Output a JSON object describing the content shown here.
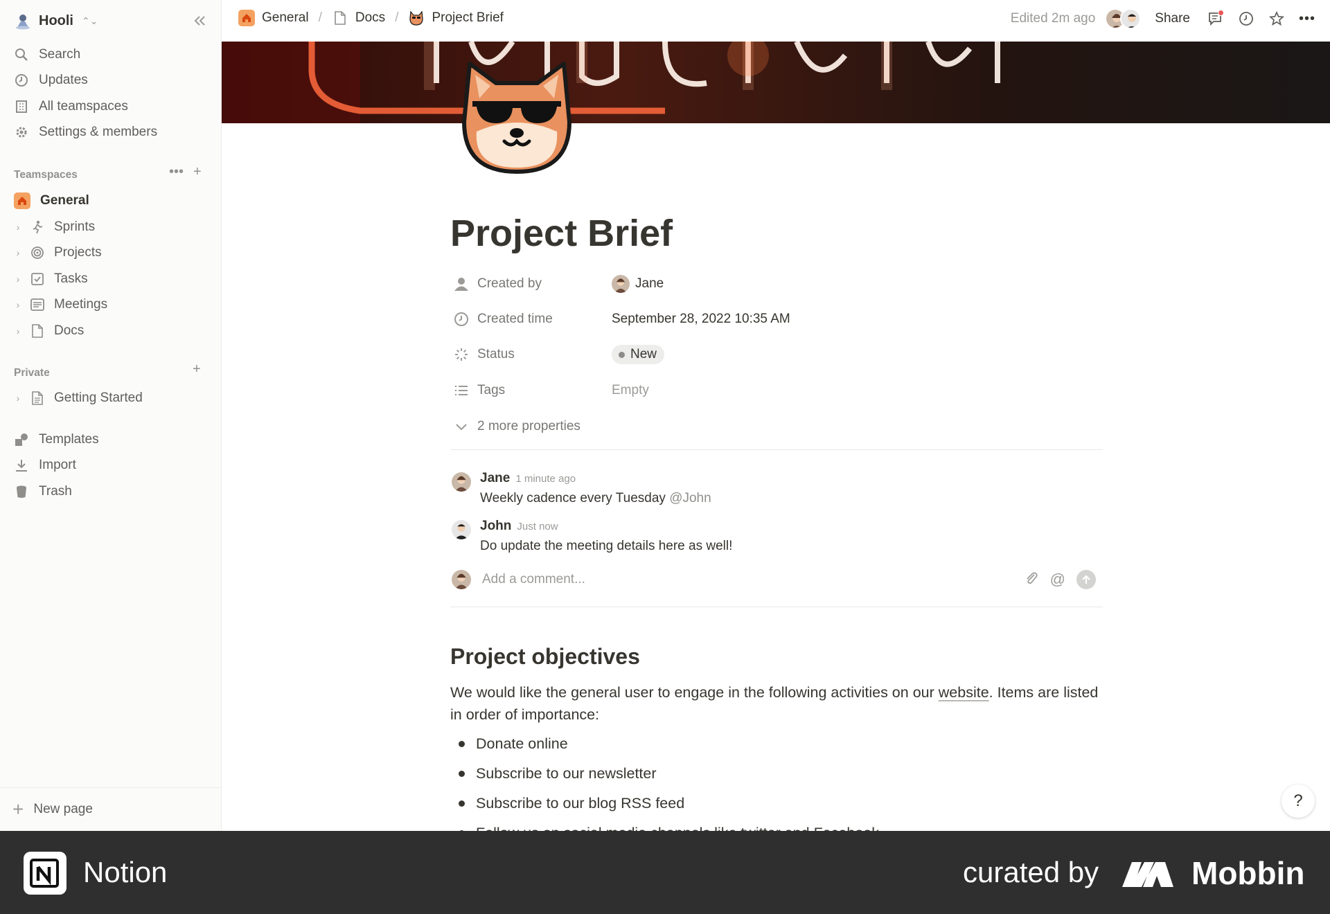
{
  "workspace": {
    "name": "Hooli",
    "switch_icon": "chevron-updown-icon"
  },
  "sidebar": {
    "top_items": [
      {
        "label": "Search",
        "icon": "search-icon"
      },
      {
        "label": "Updates",
        "icon": "clock-icon"
      },
      {
        "label": "All teamspaces",
        "icon": "building-icon"
      },
      {
        "label": "Settings & members",
        "icon": "gear-icon"
      }
    ],
    "teamspaces_header": "Teamspaces",
    "teamspaces": [
      {
        "label": "General",
        "icon": "home-icon"
      },
      {
        "label": "Sprints",
        "icon": "runner-icon"
      },
      {
        "label": "Projects",
        "icon": "target-icon"
      },
      {
        "label": "Tasks",
        "icon": "checkbox-icon"
      },
      {
        "label": "Meetings",
        "icon": "notes-icon"
      },
      {
        "label": "Docs",
        "icon": "document-icon"
      }
    ],
    "private_header": "Private",
    "private": [
      {
        "label": "Getting Started",
        "icon": "page-icon"
      }
    ],
    "bottom_items": [
      {
        "label": "Templates",
        "icon": "shapes-icon"
      },
      {
        "label": "Import",
        "icon": "download-icon"
      },
      {
        "label": "Trash",
        "icon": "trash-icon"
      }
    ],
    "new_page": "New page"
  },
  "topbar": {
    "breadcrumb": [
      "General",
      "Docs",
      "Project Brief"
    ],
    "edited": "Edited 2m ago",
    "share": "Share"
  },
  "page": {
    "title": "Project Brief",
    "properties": [
      {
        "name": "Created by",
        "value": "Jane",
        "icon": "person-icon"
      },
      {
        "name": "Created time",
        "value": "September 28, 2022 10:35 AM",
        "icon": "clock-icon"
      },
      {
        "name": "Status",
        "value": "New",
        "icon": "status-icon"
      },
      {
        "name": "Tags",
        "value": "Empty",
        "icon": "list-icon"
      }
    ],
    "more_properties": "2 more properties",
    "comments": [
      {
        "author": "Jane",
        "time": "1 minute ago",
        "text": "Weekly cadence every Tuesday",
        "mention": "@John"
      },
      {
        "author": "John",
        "time": "Just now",
        "text": "Do update the meeting details here as well!",
        "mention": ""
      }
    ],
    "comment_placeholder": "Add a comment...",
    "heading": "Project objectives",
    "paragraph_before": "We would like the general user to engage in the following activities on our ",
    "paragraph_link": "website",
    "paragraph_after": ". Items are listed in order of importance:",
    "bullets": [
      "Donate online",
      "Subscribe to our newsletter",
      "Subscribe to our blog RSS feed",
      "Follow us on social media channels like twitter and Facebook"
    ]
  },
  "help": "?",
  "footer": {
    "app": "Notion",
    "curated": "curated by",
    "brand": "Mobbin"
  },
  "colors": {
    "accent_orange": "#f4a261",
    "footer_bg": "#2f2f2f",
    "notify_red": "#eb5757"
  }
}
